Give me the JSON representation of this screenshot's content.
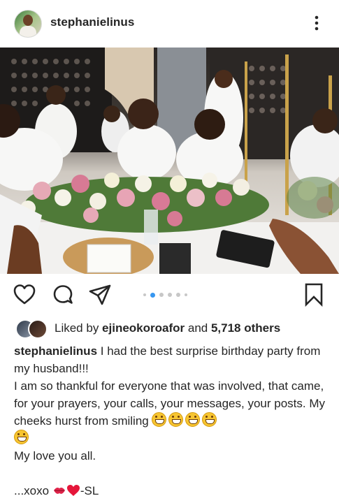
{
  "header": {
    "username": "stephanielinus",
    "more_icon": "more-vertical-icon"
  },
  "post": {
    "image_alt": "Birthday dinner table with flowers"
  },
  "actions": {
    "like_icon": "heart-outline-icon",
    "comment_icon": "comment-bubble-icon",
    "share_icon": "paper-plane-icon",
    "save_icon": "bookmark-outline-icon",
    "carousel_total": 6,
    "carousel_active": 2
  },
  "likes": {
    "prefix": "Liked by ",
    "user": "ejineokoroafor",
    "middle": " and ",
    "count": "5,718 others"
  },
  "caption": {
    "username": "stephanielinus",
    "line1": " I had the best surprise birthday party from my husband!!!",
    "line2": "I am so thankful for everyone that was involved, that came, for your prayers, your calls, your messages, your posts. My cheeks hurst from smiling ",
    "line3": "My love you all.",
    "sign_prefix": "...xoxo ",
    "sign_suffix": "-SL"
  },
  "colors": {
    "accent_dot": "#3897f0",
    "text": "#262626"
  }
}
